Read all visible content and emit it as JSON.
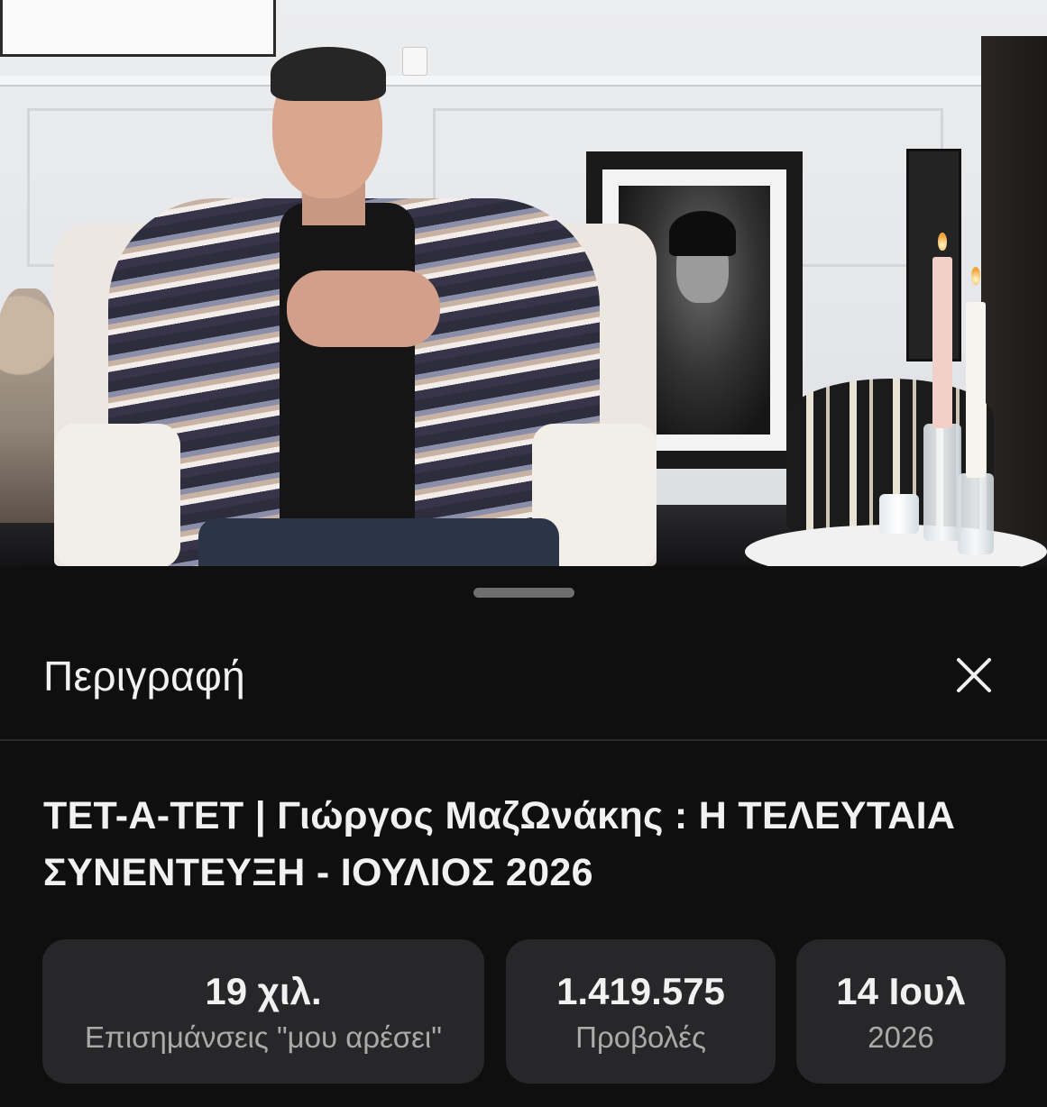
{
  "sheet": {
    "title": "Περιγραφή",
    "close_icon": "close-icon"
  },
  "video": {
    "title": "ΤΕΤ-Α-ΤΕΤ | Γιώργος ΜαζΩνάκης : Η ΤΕΛΕΥΤΑΙΑ ΣΥΝΕΝΤΕΥΞΗ - ΙΟΥΛΙΟΣ 2026"
  },
  "stats": {
    "likes": {
      "value": "19 χιλ.",
      "label": "Επισημάνσεις \"μου αρέσει\""
    },
    "views": {
      "value": "1.419.575",
      "label": "Προβολές"
    },
    "date": {
      "value": "14 Ιουλ",
      "label": "2026"
    }
  },
  "colors": {
    "sheet_background": "#0f0f0f",
    "stat_card": "#27272a",
    "primary_text": "#f1f1f1",
    "secondary_text": "#aaaaaa"
  }
}
